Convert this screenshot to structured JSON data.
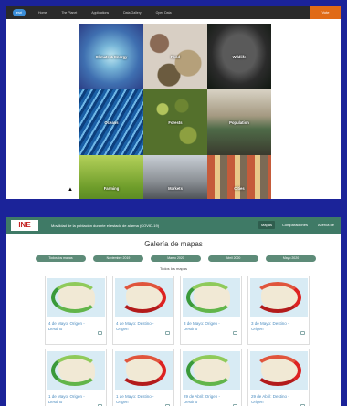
{
  "top": {
    "logo": "esri",
    "nav": [
      "Home",
      "The Planet",
      "Applications",
      "Data Gallery",
      "Open Data"
    ],
    "cta": "Vote",
    "tiles": [
      "Climate & Energy",
      "Food",
      "Wildlife",
      "Oceans",
      "Forests",
      "Population",
      "Farming",
      "Markets",
      "Cities"
    ]
  },
  "bottom": {
    "logo": "INE",
    "title": "Movilidad de la población durante el estado de alarma (COVID-19)",
    "nav": [
      "Mapas",
      "Comparaciones",
      "Acerca de"
    ],
    "gallery_title": "Galería de mapas",
    "filters": [
      "Todos los mapas",
      "Noviembre 2019",
      "Marzo 2020",
      "Abril 2020",
      "Mayo 2020"
    ],
    "subhead": "Todos los mapas",
    "cards": [
      {
        "label": "4 de Mayo: Origen - Destino",
        "color": "green"
      },
      {
        "label": "4 de Mayo: Destino - Origen",
        "color": "red"
      },
      {
        "label": "3 de Mayo: Origen - Destino",
        "color": "green"
      },
      {
        "label": "3 de Mayo: Destino - Origen",
        "color": "red"
      },
      {
        "label": "1 de Mayo: Origen - Destino",
        "color": "green"
      },
      {
        "label": "1 de Mayo: Destino - Origen",
        "color": "red"
      },
      {
        "label": "29 de Abril: Origen - Destino",
        "color": "green"
      },
      {
        "label": "29 de Abril: Destino - Origen",
        "color": "red"
      }
    ]
  }
}
